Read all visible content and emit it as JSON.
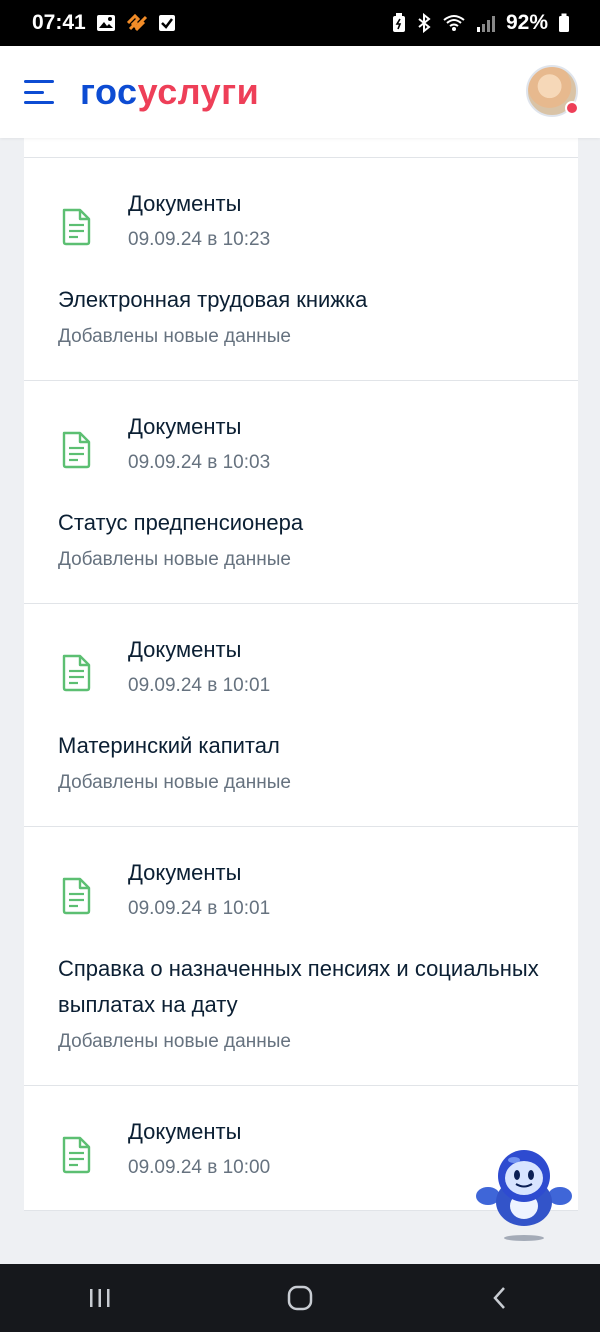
{
  "status_bar": {
    "time": "07:41",
    "battery": "92%"
  },
  "header": {
    "logo_part1": "гос",
    "logo_part2": "услуги",
    "colors": {
      "brand_blue": "#0d4cd3",
      "brand_red": "#ee3f58"
    }
  },
  "cards": [
    {
      "category": "Документы",
      "date": "09.09.24 в 10:23",
      "title": "Электронная трудовая книжка",
      "subtitle": "Добавлены новые данные",
      "icon": "document-icon"
    },
    {
      "category": "Документы",
      "date": "09.09.24 в 10:03",
      "title": "Статус предпенсионера",
      "subtitle": "Добавлены новые данные",
      "icon": "document-icon"
    },
    {
      "category": "Документы",
      "date": "09.09.24 в 10:01",
      "title": "Материнский капитал",
      "subtitle": "Добавлены новые данные",
      "icon": "document-icon"
    },
    {
      "category": "Документы",
      "date": "09.09.24 в 10:01",
      "title": "Справка о назначенных пенсиях и социальных выплатах на дату",
      "subtitle": "Добавлены новые данные",
      "icon": "document-icon"
    },
    {
      "category": "Документы",
      "date": "09.09.24 в 10:00",
      "icon": "document-icon"
    }
  ],
  "nav": {
    "buttons": [
      "recent-apps-icon",
      "home-icon",
      "back-icon"
    ]
  }
}
